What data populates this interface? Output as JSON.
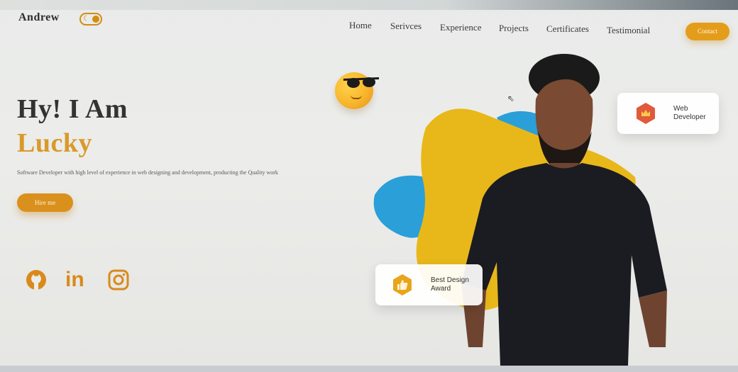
{
  "header": {
    "logo": "Andrew",
    "nav": [
      "Home",
      "Serivces",
      "Experience",
      "Projects",
      "Certificates",
      "Testimonial"
    ],
    "contact_label": "Contact"
  },
  "hero": {
    "greeting": "Hy! I Am",
    "name": "Lucky",
    "tagline": "Software Developer with high level of experience in web designing and development, producting the Quality work",
    "hire_label": "Hire me"
  },
  "badges": {
    "web_line1": "Web",
    "web_line2": "Developer",
    "award_line1": "Best Design",
    "award_line2": "Award"
  },
  "socials": [
    "github-icon",
    "linkedin-icon",
    "instagram-icon"
  ],
  "colors": {
    "accent": "#d99a2a",
    "yellow_blob": "#e8b81a",
    "blue_blob": "#2a9fd8"
  }
}
